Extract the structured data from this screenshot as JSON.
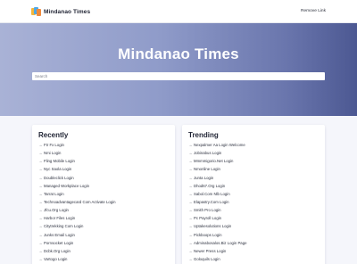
{
  "header": {
    "logo_text": "Mindanao Times",
    "remove_link": "Remove Link"
  },
  "hero": {
    "title": "Mindanao Times",
    "search_placeholder": "Search"
  },
  "recently": {
    "title": "Recently",
    "items": [
      "Ftr Fx Login",
      "Nmi Login",
      "Fling Mobile Login",
      "Nyc Saola Login",
      "Doubleclick Login",
      "Managed Workplace Login",
      "Tarrat Login",
      "Technoadvantagecard Com Activate Login",
      "Jfcu.Org Login",
      "Harbor Files Login",
      "Citytrekking Com Login",
      "Junks Email Login",
      "Pornsocket Login",
      "Dcbk.Org Login",
      "Vartogo Login"
    ]
  },
  "trending": {
    "title": "Trending",
    "items": [
      "Nexpalmer Aa Login Welcome",
      "Jobinabus Login",
      "Mmmmigorio.Net Login",
      "Nmonline Login",
      "Junta Login",
      "Dhod67.Org Login",
      "Sabol.Com Nlb Login",
      "Elapastry.Com Login",
      "Smith Pro Login",
      "Pc Payroll Login",
      "Uptakesolutions Login",
      "Pickboops Login",
      "Adminabosalos.Biz Login Page",
      "Newer Press Login",
      "Goloquils Login"
    ]
  },
  "icons": {
    "list_arrow": "arrow-right-icon",
    "logo": "mindanao-times-logo-icon"
  },
  "colors": {
    "hero_gradient_start": "#a9b2d6",
    "hero_gradient_end": "#4c5892",
    "page_background": "#f5f6fb"
  }
}
